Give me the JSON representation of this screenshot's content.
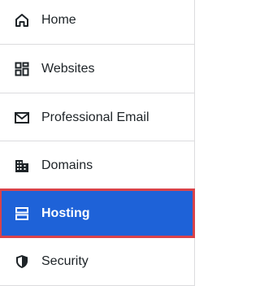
{
  "nav": {
    "items": [
      {
        "label": "Home",
        "icon": "home-icon"
      },
      {
        "label": "Websites",
        "icon": "websites-grid-icon"
      },
      {
        "label": "Professional Email",
        "icon": "email-icon"
      },
      {
        "label": "Domains",
        "icon": "domains-building-icon"
      },
      {
        "label": "Hosting",
        "icon": "hosting-server-icon",
        "active": true
      },
      {
        "label": "Security",
        "icon": "shield-icon"
      }
    ]
  },
  "colors": {
    "active_background": "#1e62d8",
    "active_outline": "#d9434a",
    "text": "#1d2327",
    "divider": "#dcdcde"
  }
}
